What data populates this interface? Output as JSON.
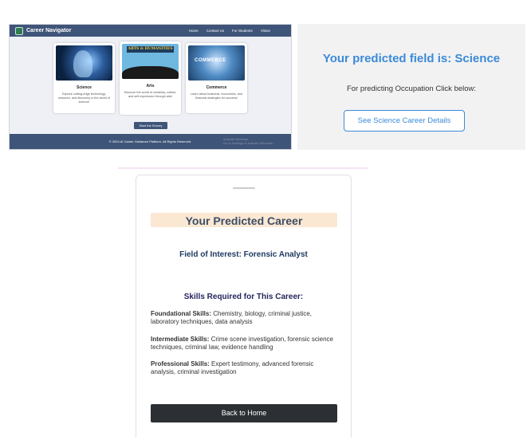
{
  "site": {
    "brand": "Career Navigator",
    "nav": [
      "Home",
      "Contact Us",
      "For Students",
      "Vision"
    ],
    "cards": [
      {
        "title": "Science",
        "image_text": "",
        "description": "Explore cutting-edge technology, research, and discovery in the world of science!"
      },
      {
        "title": "Arts",
        "image_text": "ARTS & HUMANITIES",
        "description": "Discover the world of creativity, culture, and self-expression through arts!"
      },
      {
        "title": "Commerce",
        "image_text": "COMMERCE",
        "description": "Learn about business, economics, and financial strategies for success!"
      }
    ],
    "survey_button": "Start the Survey",
    "footer": "© 2024 AI Career Guidance Platform. All Rights Reserved.",
    "watermark_line1": "Activate Windows",
    "watermark_line2": "Go to Settings to activate Windows."
  },
  "prediction": {
    "title": "Your predicted field is: Science",
    "subtitle": "For predicting Occupation Click below:",
    "button": "See Science Career Details"
  },
  "career": {
    "title": "Your Predicted Career",
    "field": "Field of Interest: Forensic Analyst",
    "skills_heading": "Skills Required for This Career:",
    "skills": [
      {
        "label": "Foundational Skills:",
        "text": "Chemistry, biology, criminal justice, laboratory techniques, data analysis"
      },
      {
        "label": "Intermediate Skills:",
        "text": "Crime scene investigation, forensic science techniques, criminal law, evidence handling"
      },
      {
        "label": "Professional Skills:",
        "text": "Expert testimony, advanced forensic analysis, criminal investigation"
      }
    ],
    "back_button": "Back to Home"
  },
  "colors": {
    "nav": "#3f5479",
    "accent": "#3b8ad9",
    "title_highlight": "#fbe8d3",
    "dark_button": "#2c2f33"
  }
}
